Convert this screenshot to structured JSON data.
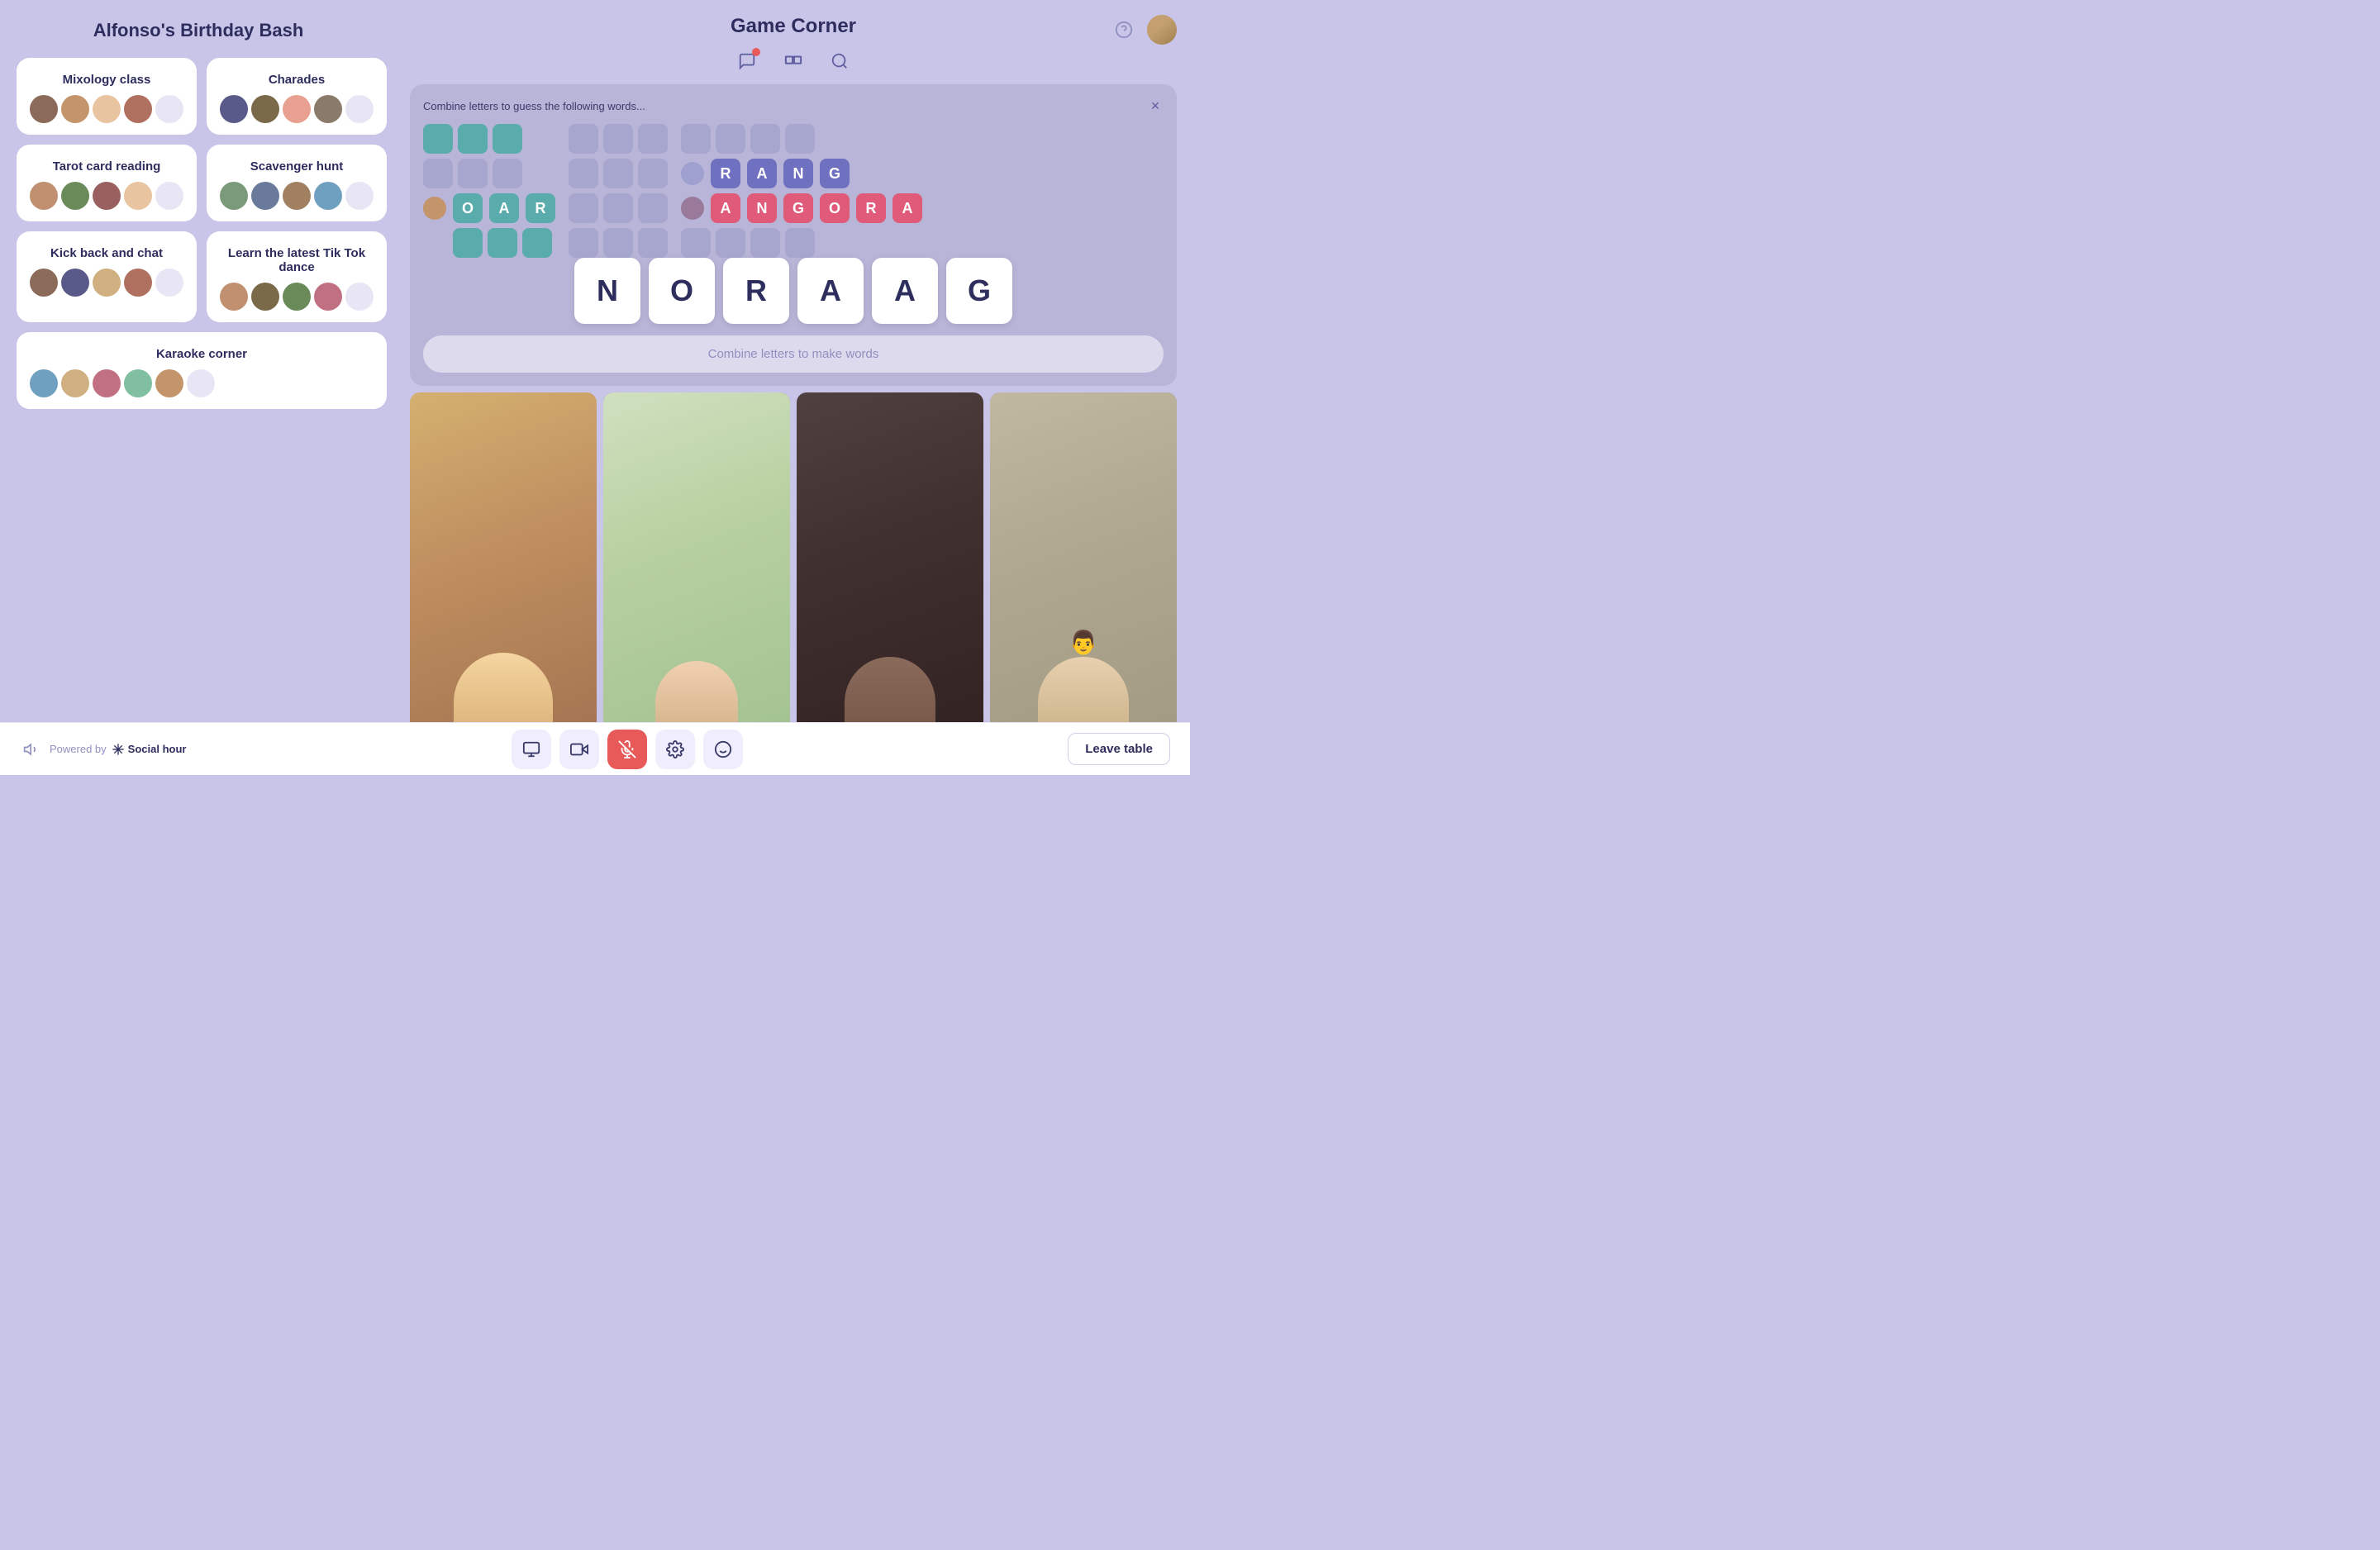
{
  "app": {
    "title": "Alfonso's Birthday Bash",
    "game_corner_title": "Game Corner",
    "powered_by": "Powered by",
    "social_hour": "Social hour",
    "leave_table": "Leave table"
  },
  "rooms": [
    {
      "id": "mixology",
      "name": "Mixology class",
      "avatars": 4
    },
    {
      "id": "charades",
      "name": "Charades",
      "avatars": 4
    },
    {
      "id": "tarot",
      "name": "Tarot card reading",
      "avatars": 4
    },
    {
      "id": "scavenger",
      "name": "Scavenger hunt",
      "avatars": 4
    },
    {
      "id": "kickback",
      "name": "Kick back and chat",
      "avatars": 4
    },
    {
      "id": "tiktok",
      "name": "Learn the latest Tik Tok dance",
      "avatars": 4
    },
    {
      "id": "karaoke",
      "name": "Karaoke corner",
      "avatars": 5
    }
  ],
  "game": {
    "instruction": "Combine letters to guess the following words...",
    "letters": [
      "N",
      "O",
      "R",
      "A",
      "A",
      "G"
    ],
    "input_placeholder": "Combine letters to make words",
    "word1": [
      "O",
      "A",
      "R"
    ],
    "word2_top": [
      "R",
      "A",
      "N",
      "G"
    ],
    "word2_bottom": [
      "A",
      "N",
      "G",
      "O",
      "R",
      "A"
    ]
  },
  "bottom_controls": {
    "screen_icon": "🖥",
    "video_icon": "📷",
    "mic_icon": "🎤",
    "settings_icon": "⚙",
    "emoji_icon": "😊",
    "leave_label": "Leave table",
    "volume_icon": "🔈"
  }
}
